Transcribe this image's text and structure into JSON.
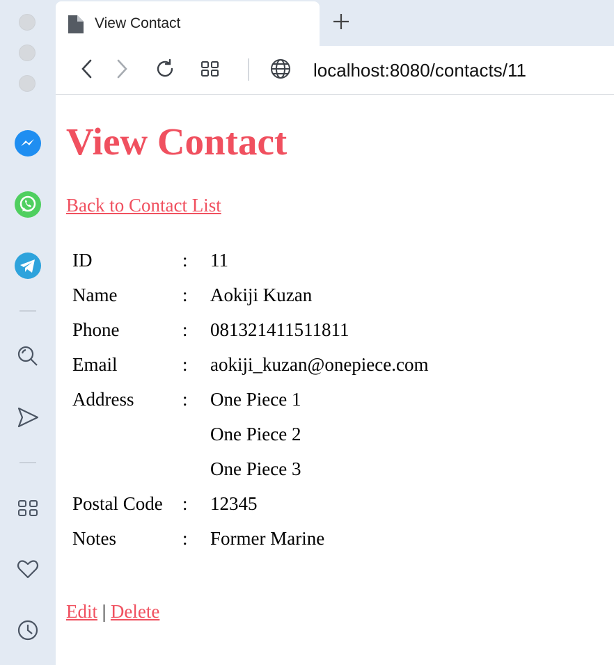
{
  "browser": {
    "tab_title": "View Contact",
    "url": "localhost:8080/contacts/11"
  },
  "sidebar": {
    "apps": [
      {
        "name": "messenger-icon",
        "color": "#1f8ef1"
      },
      {
        "name": "whatsapp-icon",
        "color": "#4fcf5f"
      },
      {
        "name": "telegram-icon",
        "color": "#2ea3dc"
      }
    ],
    "tools": [
      "search-icon",
      "send-icon",
      "apps-grid-icon",
      "heart-icon",
      "history-icon"
    ]
  },
  "page": {
    "heading": "View Contact",
    "back_link": "Back to Contact List",
    "accent_color": "#f0505f",
    "fields": [
      {
        "label": "ID",
        "sep": ":",
        "value": "11"
      },
      {
        "label": "Name",
        "sep": ":",
        "value": "Aokiji Kuzan"
      },
      {
        "label": "Phone",
        "sep": ":",
        "value": "081321411511811"
      },
      {
        "label": "Email",
        "sep": ":",
        "value": "aokiji_kuzan@onepiece.com"
      },
      {
        "label": "Address",
        "sep": ":",
        "value": "One Piece 1"
      },
      {
        "label": "",
        "sep": "",
        "value": "One Piece 2"
      },
      {
        "label": "",
        "sep": "",
        "value": "One Piece 3"
      },
      {
        "label": "Postal Code",
        "sep": ":",
        "value": "12345"
      },
      {
        "label": "Notes",
        "sep": ":",
        "value": "Former Marine"
      }
    ],
    "edit_link": "Edit",
    "divider": "|",
    "delete_link": "Delete"
  }
}
